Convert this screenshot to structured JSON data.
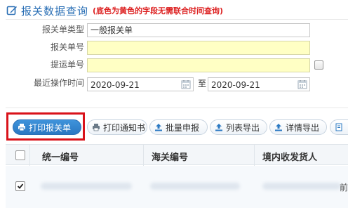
{
  "header": {
    "title": "报关数据查询",
    "note": "(底色为黄色的字段无需联合时间查询)"
  },
  "form": {
    "declaration_type_label": "报关单类型",
    "declaration_type_value": "一般报关单",
    "declaration_no_label": "报关单号",
    "declaration_no_value": "",
    "bill_no_label": "提运单号",
    "bill_no_value": "",
    "recent_time_label": "最近操作时间",
    "date_from": "2020-09-21",
    "between_label": "至",
    "date_to": "2020-09-21"
  },
  "toolbar": {
    "print_declaration": "打印报关单",
    "print_notice": "打印通知书",
    "batch_declare": "批量申报",
    "export_list": "列表导出",
    "export_detail": "详情导出"
  },
  "grid": {
    "columns": [
      "统一编号",
      "海关编号",
      "境内收发货人"
    ],
    "row_checked": true,
    "edge_char": "前"
  },
  "colors": {
    "accent": "#2a6fb5",
    "note_red": "#dd2222",
    "highlight_red": "#d9121a",
    "yellow_field": "#ffffc4"
  }
}
